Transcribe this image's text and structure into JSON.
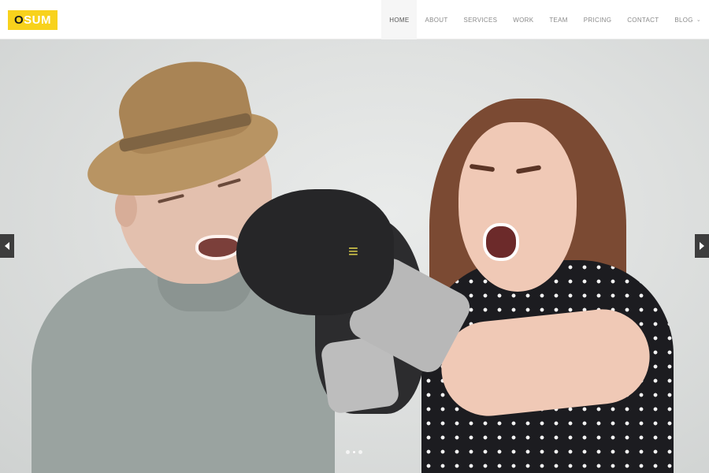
{
  "brand": {
    "logo_first_letter": "O",
    "logo_rest": "SUM",
    "accent_color": "#f8d21c"
  },
  "nav": {
    "items": [
      {
        "label": "HOME",
        "active": true
      },
      {
        "label": "ABOUT"
      },
      {
        "label": "SERVICES"
      },
      {
        "label": "WORK"
      },
      {
        "label": "TEAM"
      },
      {
        "label": "PRICING"
      },
      {
        "label": "CONTACT"
      },
      {
        "label": "BLOG",
        "has_dropdown": true
      }
    ]
  },
  "hero": {
    "slide_count": 3,
    "active_slide": 2,
    "prev_icon": "chevron-left-icon",
    "next_icon": "chevron-right-icon"
  }
}
